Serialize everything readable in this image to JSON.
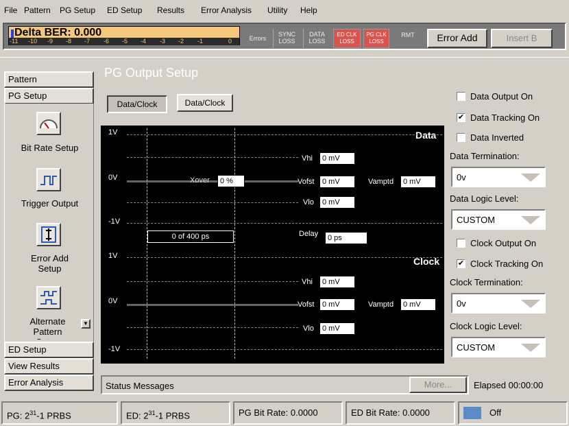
{
  "menu": [
    "File",
    "Pattern",
    "PG Setup",
    "ED Setup",
    "Results",
    "Error Analysis",
    "Utility",
    "Help"
  ],
  "ber": {
    "title": "Delta BER: 0.000",
    "scale": [
      "-11",
      "-10",
      "-9",
      "-8",
      "-7",
      "-6",
      "-5",
      "-4",
      "-3",
      "-2",
      "-1",
      "0"
    ]
  },
  "indicators": {
    "errors": "Errors",
    "sync_loss": "SYNC LOSS",
    "data_loss": "DATA LOSS",
    "ed_clk_loss": "ED CLK LOSS",
    "pg_clk_loss": "PG CLK LOSS",
    "rmt": "RMT"
  },
  "buttons": {
    "error_add": "Error Add",
    "insert_b": "Insert B",
    "more": "More..."
  },
  "nav": {
    "pattern": "Pattern",
    "pg_setup": "PG Setup",
    "ed_setup": "ED Setup",
    "view_results": "View Results",
    "error_analysis": "Error Analysis",
    "items": [
      "Bit Rate Setup",
      "Trigger Output",
      "Error Add Setup",
      "Alternate Pattern Setup"
    ]
  },
  "main": {
    "title": "PG Output Setup",
    "toggle1": "Data/Clock",
    "toggle2": "Data/Clock"
  },
  "scope": {
    "data_label": "Data",
    "clock_label": "Clock",
    "v1": "1V",
    "v0": "0V",
    "vn1": "-1V",
    "xover_label": "Xover",
    "xover_value": "0 %",
    "vhi_label": "Vhi",
    "vhi_value": "0 mV",
    "vofst_label": "Vofst",
    "vofst_value": "0 mV",
    "vampt_label": "Vamptd",
    "vampt_value": "0 mV",
    "vlo_label": "Vlo",
    "vlo_value": "0 mV",
    "delay_range": "0 of 400 ps",
    "delay_label": "Delay",
    "delay_value": "0 ps",
    "cvhi_value": "0 mV",
    "cvofst_value": "0 mV",
    "cvampt_value": "0 mV",
    "cvlo_value": "0 mV"
  },
  "right": {
    "data_output_on": "Data Output On",
    "data_tracking_on": "Data Tracking On",
    "data_inverted": "Data Inverted",
    "data_termination_label": "Data Termination:",
    "data_termination_value": "0v",
    "data_logic_label": "Data Logic Level:",
    "data_logic_value": "CUSTOM",
    "clock_output_on": "Clock Output On",
    "clock_tracking_on": "Clock Tracking On",
    "clock_termination_label": "Clock Termination:",
    "clock_termination_value": "0v",
    "clock_logic_label": "Clock Logic Level:",
    "clock_logic_value": "CUSTOM",
    "checkmark": "✔"
  },
  "status": {
    "messages": "Status Messages",
    "elapsed": "Elapsed 00:00:00"
  },
  "bottom": {
    "pg_prefix": "PG: 2",
    "ed_prefix": "ED: 2",
    "exp": "31",
    "suffix": "-1 PRBS",
    "pg_rate": "PG Bit Rate: 0.0000",
    "ed_rate": "ED Bit Rate: 0.0000",
    "off": "Off"
  },
  "colors": {
    "accent": "#f4c87a",
    "scope_bg": "#000000",
    "alarm": "#d9534f",
    "panel": "#d4d0c8"
  }
}
